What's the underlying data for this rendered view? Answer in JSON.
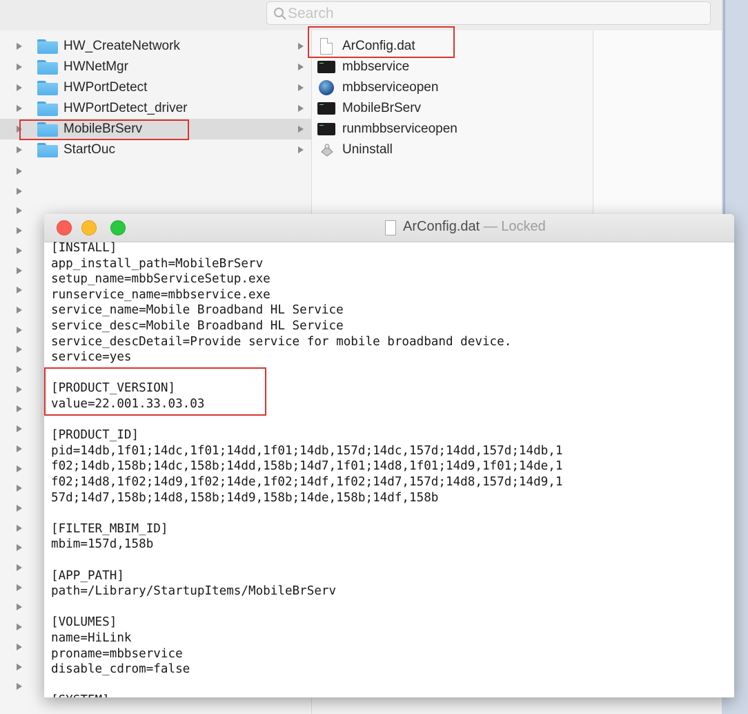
{
  "finder": {
    "search": {
      "placeholder": "Search"
    },
    "column1": [
      {
        "name": "HW_CreateNetwork"
      },
      {
        "name": "HWNetMgr"
      },
      {
        "name": "HWPortDetect"
      },
      {
        "name": "HWPortDetect_driver"
      },
      {
        "name": "MobileBrServ",
        "selected": true
      },
      {
        "name": "StartOuc"
      }
    ],
    "column2": [
      {
        "name": "ArConfig.dat",
        "icon": "document-icon"
      },
      {
        "name": "mbbservice",
        "icon": "terminal-exec-icon"
      },
      {
        "name": "mbbserviceopen",
        "icon": "globe-app-icon"
      },
      {
        "name": "MobileBrServ",
        "icon": "terminal-exec-icon"
      },
      {
        "name": "runmbbserviceopen",
        "icon": "terminal-exec-icon"
      },
      {
        "name": "Uninstall",
        "icon": "uninstall-app-icon"
      }
    ]
  },
  "editor": {
    "title": "ArConfig.dat",
    "title_status": "— Locked",
    "lines": [
      "[INSTALL]",
      "app_install_path=MobileBrServ",
      "setup_name=mbbServiceSetup.exe",
      "runservice_name=mbbservice.exe",
      "service_name=Mobile Broadband HL Service",
      "service_desc=Mobile Broadband HL Service",
      "service_descDetail=Provide service for mobile broadband device.",
      "service=yes",
      "",
      "[PRODUCT_VERSION]",
      "value=22.001.33.03.03",
      "",
      "[PRODUCT_ID]",
      "pid=14db,1f01;14dc,1f01;14dd,1f01;14db,157d;14dc,157d;14dd,157d;14db,1",
      "f02;14db,158b;14dc,158b;14dd,158b;14d7,1f01;14d8,1f01;14d9,1f01;14de,1",
      "f02;14d8,1f02;14d9,1f02;14de,1f02;14df,1f02;14d7,157d;14d8,157d;14d9,1",
      "57d;14d7,158b;14d8,158b;14d9,158b;14de,158b;14df,158b",
      "",
      "[FILTER_MBIM_ID]",
      "mbim=157d,158b",
      "",
      "[APP_PATH]",
      "path=/Library/StartupItems/MobileBrServ",
      "",
      "[VOLUMES]",
      "name=HiLink",
      "proname=mbbservice",
      "disable_cdrom=false",
      "",
      "[SYSTEM]"
    ]
  },
  "colors": {
    "highlight_box": "#d9352f",
    "folder": "#56b2ec",
    "close": "#fc5f57",
    "minimize": "#fdbd2e",
    "zoom": "#28c840"
  }
}
